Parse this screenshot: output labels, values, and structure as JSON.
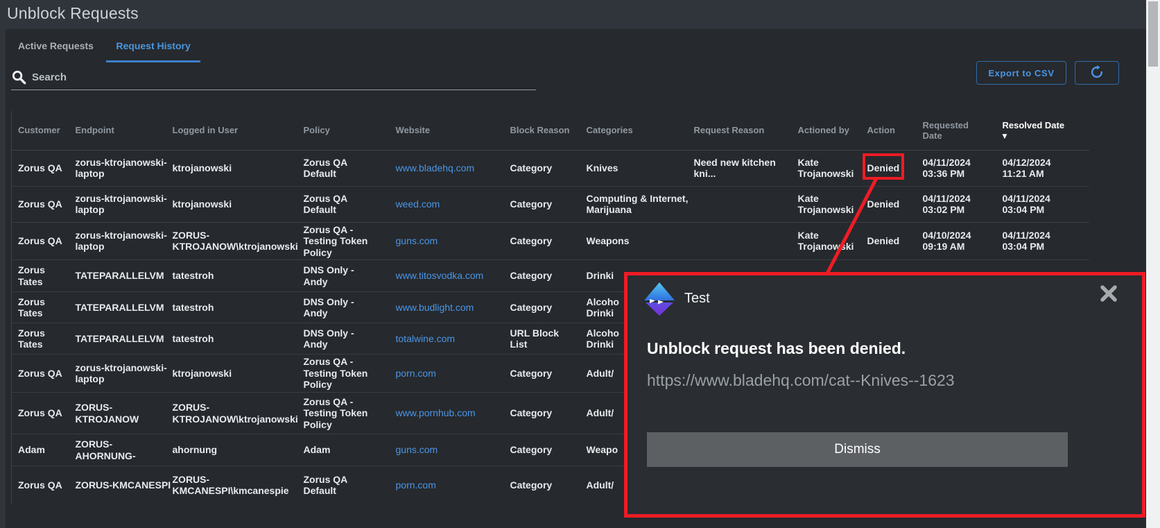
{
  "page": {
    "title": "Unblock Requests"
  },
  "tabs": [
    {
      "label": "Active Requests",
      "active": false
    },
    {
      "label": "Request History",
      "active": true
    }
  ],
  "search": {
    "placeholder": "Search",
    "icon": "magnifier-icon"
  },
  "toolbar": {
    "export_label": "Export to CSV",
    "refresh_icon": "clockwise-circular-arrow-icon"
  },
  "table": {
    "headers": [
      {
        "label": "Customer"
      },
      {
        "label": "Endpoint"
      },
      {
        "label": "Logged in User"
      },
      {
        "label": "Policy"
      },
      {
        "label": "Website"
      },
      {
        "label": "Block Reason"
      },
      {
        "label": "Categories"
      },
      {
        "label": "Request Reason"
      },
      {
        "label": "Actioned by"
      },
      {
        "label": "Action"
      },
      {
        "label": "Requested\nDate"
      },
      {
        "label": "Resolved Date",
        "sorted": true,
        "sort_icon": "▼",
        "sort_direction": "descending"
      }
    ],
    "rows": [
      {
        "customer": "Zorus QA",
        "endpoint": "zorus-ktrojanowski-\nlaptop",
        "logged_in_user": "ktrojanowski",
        "policy": "Zorus QA\nDefault",
        "website": "www.bladehq.com",
        "block_reason": "Category",
        "categories": "Knives",
        "request_reason": "Need new kitchen\nkni...",
        "actioned_by": "Kate\nTrojanowski",
        "action": "Denied",
        "requested_date": "04/11/2024\n03:36 PM",
        "resolved_date": "04/12/2024\n11:21 AM"
      },
      {
        "customer": "Zorus QA",
        "endpoint": "zorus-ktrojanowski-\nlaptop",
        "logged_in_user": "ktrojanowski",
        "policy": "Zorus QA\nDefault",
        "website": "weed.com",
        "block_reason": "Category",
        "categories": "Computing & Internet,\nMarijuana",
        "request_reason": "",
        "actioned_by": "Kate\nTrojanowski",
        "action": "Denied",
        "requested_date": "04/11/2024\n03:02 PM",
        "resolved_date": "04/11/2024\n03:04 PM"
      },
      {
        "customer": "Zorus QA",
        "endpoint": "zorus-ktrojanowski-\nlaptop",
        "logged_in_user": "ZORUS-\nKTROJANOW\\ktrojanowski",
        "policy": "Zorus QA -\nTesting Token\nPolicy",
        "website": "guns.com",
        "block_reason": "Category",
        "categories": "Weapons",
        "request_reason": "",
        "actioned_by": "Kate\nTrojanowski",
        "action": "Denied",
        "requested_date": "04/10/2024\n09:19 AM",
        "resolved_date": "04/11/2024\n03:04 PM"
      },
      {
        "customer": "Zorus\nTates",
        "endpoint": "TATEPARALLELVM",
        "logged_in_user": "tatestroh",
        "policy": "DNS Only -\nAndy",
        "website": "www.titosvodka.com",
        "block_reason": "Category",
        "categories": "Drinki",
        "request_reason": "",
        "actioned_by": "",
        "action": "",
        "requested_date": "",
        "resolved_date": ""
      },
      {
        "customer": "Zorus\nTates",
        "endpoint": "TATEPARALLELVM",
        "logged_in_user": "tatestroh",
        "policy": "DNS Only -\nAndy",
        "website": "www.budlight.com",
        "block_reason": "Category",
        "categories": "Alcoho\nDrinki",
        "request_reason": "",
        "actioned_by": "",
        "action": "",
        "requested_date": "",
        "resolved_date": ""
      },
      {
        "customer": "Zorus\nTates",
        "endpoint": "TATEPARALLELVM",
        "logged_in_user": "tatestroh",
        "policy": "DNS Only -\nAndy",
        "website": "totalwine.com",
        "block_reason": "URL Block\nList",
        "categories": "Alcoho\nDrinki",
        "request_reason": "",
        "actioned_by": "",
        "action": "",
        "requested_date": "",
        "resolved_date": ""
      },
      {
        "customer": "Zorus QA",
        "endpoint": "zorus-ktrojanowski-\nlaptop",
        "logged_in_user": "ktrojanowski",
        "policy": "Zorus QA -\nTesting Token\nPolicy",
        "website": "porn.com",
        "block_reason": "Category",
        "categories": "Adult/",
        "request_reason": "",
        "actioned_by": "",
        "action": "",
        "requested_date": "",
        "resolved_date": ""
      },
      {
        "customer": "Zorus QA",
        "endpoint": "ZORUS-\nKTROJANOW",
        "logged_in_user": "ZORUS-\nKTROJANOW\\ktrojanowski",
        "policy": "Zorus QA -\nTesting Token\nPolicy",
        "website": "www.pornhub.com",
        "block_reason": "Category",
        "categories": "Adult/",
        "request_reason": "",
        "actioned_by": "",
        "action": "",
        "requested_date": "",
        "resolved_date": ""
      },
      {
        "customer": "Adam",
        "endpoint": "ZORUS-\nAHORNUNG-",
        "logged_in_user": "ahornung",
        "policy": "Adam",
        "website": "guns.com",
        "block_reason": "Category",
        "categories": "Weapo",
        "request_reason": "",
        "actioned_by": "",
        "action": "",
        "requested_date": "",
        "resolved_date": ""
      },
      {
        "customer": "Zorus QA",
        "endpoint": "ZORUS-KMCANESPI",
        "logged_in_user": "ZORUS-\nKMCANESPI\\kmcanespie",
        "policy": "Zorus QA\nDefault",
        "website": "porn.com",
        "block_reason": "Category",
        "categories": "Adult/",
        "request_reason": "",
        "actioned_by": "",
        "action": "",
        "requested_date": "",
        "resolved_date": ""
      }
    ]
  },
  "annotation": {
    "color": "#ee1c25",
    "highlighted_value": "Denied",
    "shape": "box-with-connector-line"
  },
  "popup": {
    "logo_icon": "zorus-diamond-logo",
    "app_name": "Test",
    "close_icon": "x-icon",
    "message": "Unblock request has been denied.",
    "url": "https://www.bladehq.com/cat--Knives--1623",
    "dismiss_label": "Dismiss"
  },
  "colors": {
    "accent_blue": "#4a96e8",
    "tab_active_blue": "#4a96e0",
    "link_blue": "#4a96e8",
    "annotation_red": "#ee1c25",
    "page_bg": "#30353b",
    "panel_bg": "#26292d",
    "popup_bg": "#2a2d31",
    "dismiss_button_bg": "#5d6063"
  }
}
